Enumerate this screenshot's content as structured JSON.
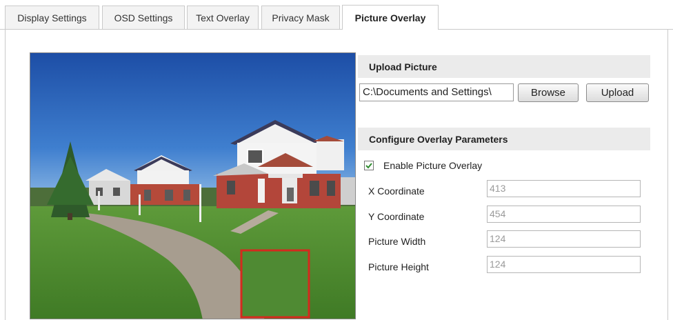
{
  "tabs": [
    {
      "label": "Display Settings",
      "active": false
    },
    {
      "label": "OSD Settings",
      "active": false
    },
    {
      "label": "Text Overlay",
      "active": false
    },
    {
      "label": "Privacy Mask",
      "active": false
    },
    {
      "label": "Picture Overlay",
      "active": true
    }
  ],
  "upload": {
    "header": "Upload Picture",
    "file_path": "C:\\Documents and Settings\\",
    "browse_label": "Browse",
    "upload_label": "Upload"
  },
  "overlay": {
    "header": "Configure Overlay Parameters",
    "enable_label": "Enable Picture Overlay",
    "enable_checked": true,
    "x_label": "X Coordinate",
    "x_value": "413",
    "y_label": "Y Coordinate",
    "y_value": "454",
    "width_label": "Picture Width",
    "width_value": "124",
    "height_label": "Picture Height",
    "height_value": "124"
  },
  "colors": {
    "overlay_border": "#d42a1e",
    "checkbox_check": "#2e8b2e"
  }
}
